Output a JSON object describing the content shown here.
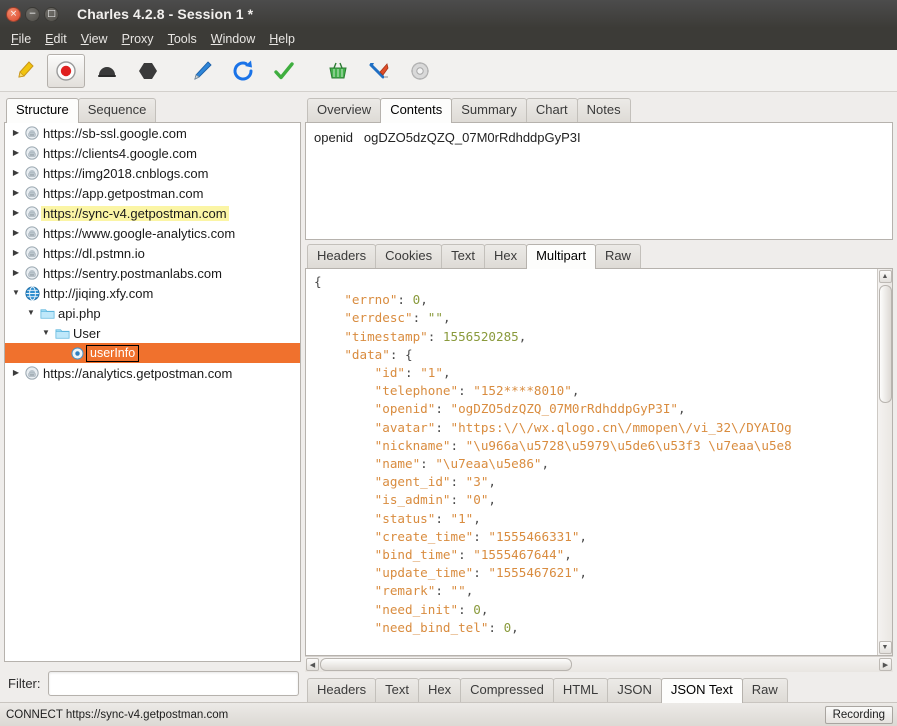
{
  "window": {
    "title": "Charles 4.2.8 - Session 1 *",
    "close_label": "×",
    "minimize_label": "−",
    "maximize_label": "□"
  },
  "menubar": {
    "items": [
      {
        "label": "File",
        "mnemonic": "F"
      },
      {
        "label": "Edit",
        "mnemonic": "E"
      },
      {
        "label": "View",
        "mnemonic": "V"
      },
      {
        "label": "Proxy",
        "mnemonic": "P"
      },
      {
        "label": "Tools",
        "mnemonic": "T"
      },
      {
        "label": "Window",
        "mnemonic": "W"
      },
      {
        "label": "Help",
        "mnemonic": "H"
      }
    ]
  },
  "toolbar": {
    "buttons": [
      {
        "name": "clear-session-icon",
        "title": "Clear Session",
        "active": false
      },
      {
        "name": "record-icon",
        "title": "Start/Stop Recording",
        "active": true
      },
      {
        "name": "throttle-icon",
        "title": "Start/Stop Throttling",
        "active": false
      },
      {
        "name": "breakpoints-icon",
        "title": "Enable/Disable Breakpoints",
        "active": false
      },
      {
        "name": "compose-icon",
        "title": "Compose a new request",
        "active": false
      },
      {
        "name": "repeat-icon",
        "title": "Repeat the selected request",
        "active": false
      },
      {
        "name": "validate-icon",
        "title": "Validate the selected request",
        "active": false
      },
      {
        "name": "tools-basket-icon",
        "title": "Tools",
        "active": false
      },
      {
        "name": "settings-tools-icon",
        "title": "Settings",
        "active": false
      },
      {
        "name": "gear-icon",
        "title": "Preferences",
        "active": false
      }
    ]
  },
  "left": {
    "tabs": [
      {
        "label": "Structure",
        "selected": true
      },
      {
        "label": "Sequence",
        "selected": false
      }
    ],
    "tree": [
      {
        "label": "https://sb-ssl.google.com",
        "depth": 0,
        "icon": "secure-host-icon",
        "twisty": "collapsed",
        "state": "normal"
      },
      {
        "label": "https://clients4.google.com",
        "depth": 0,
        "icon": "secure-host-icon",
        "twisty": "collapsed",
        "state": "normal"
      },
      {
        "label": "https://img2018.cnblogs.com",
        "depth": 0,
        "icon": "secure-host-icon",
        "twisty": "collapsed",
        "state": "normal"
      },
      {
        "label": "https://app.getpostman.com",
        "depth": 0,
        "icon": "secure-host-icon",
        "twisty": "collapsed",
        "state": "normal"
      },
      {
        "label": "https://sync-v4.getpostman.com",
        "depth": 0,
        "icon": "secure-host-icon",
        "twisty": "collapsed",
        "state": "highlighted"
      },
      {
        "label": "https://www.google-analytics.com",
        "depth": 0,
        "icon": "secure-host-icon",
        "twisty": "collapsed",
        "state": "normal"
      },
      {
        "label": "https://dl.pstmn.io",
        "depth": 0,
        "icon": "secure-host-icon",
        "twisty": "collapsed",
        "state": "normal"
      },
      {
        "label": "https://sentry.postmanlabs.com",
        "depth": 0,
        "icon": "secure-host-icon",
        "twisty": "collapsed",
        "state": "normal"
      },
      {
        "label": "http://jiqing.xfy.com",
        "depth": 0,
        "icon": "host-icon",
        "twisty": "expanded",
        "state": "normal"
      },
      {
        "label": "api.php",
        "depth": 1,
        "icon": "folder-icon",
        "twisty": "expanded",
        "state": "normal"
      },
      {
        "label": "User",
        "depth": 2,
        "icon": "folder-icon",
        "twisty": "expanded",
        "state": "normal"
      },
      {
        "label": "userInfo",
        "depth": 3,
        "icon": "endpoint-icon",
        "twisty": "none",
        "state": "selected"
      },
      {
        "label": "https://analytics.getpostman.com",
        "depth": 0,
        "icon": "secure-host-icon",
        "twisty": "collapsed",
        "state": "normal"
      }
    ],
    "filter": {
      "label": "Filter:",
      "value": "",
      "placeholder": ""
    }
  },
  "right": {
    "tabs": [
      {
        "label": "Overview",
        "selected": false
      },
      {
        "label": "Contents",
        "selected": true
      },
      {
        "label": "Summary",
        "selected": false
      },
      {
        "label": "Chart",
        "selected": false
      },
      {
        "label": "Notes",
        "selected": false
      }
    ],
    "request": {
      "multipart_line": "openid   ogDZO5dzQZQ_07M0rRdhddpGyP3I",
      "tabs": [
        {
          "label": "Headers",
          "selected": false
        },
        {
          "label": "Cookies",
          "selected": false
        },
        {
          "label": "Text",
          "selected": false
        },
        {
          "label": "Hex",
          "selected": false
        },
        {
          "label": "Multipart",
          "selected": true
        },
        {
          "label": "Raw",
          "selected": false
        }
      ]
    },
    "response": {
      "tabs": [
        {
          "label": "Headers",
          "selected": false
        },
        {
          "label": "Text",
          "selected": false
        },
        {
          "label": "Hex",
          "selected": false
        },
        {
          "label": "Compressed",
          "selected": false
        },
        {
          "label": "HTML",
          "selected": false
        },
        {
          "label": "JSON",
          "selected": false
        },
        {
          "label": "JSON Text",
          "selected": true
        },
        {
          "label": "Raw",
          "selected": false
        }
      ],
      "json_lines": [
        [
          {
            "t": "p",
            "s": "{"
          }
        ],
        [
          {
            "t": "p",
            "s": "    "
          },
          {
            "t": "k",
            "s": "\"errno\""
          },
          {
            "t": "p",
            "s": ": "
          },
          {
            "t": "v",
            "s": "0"
          },
          {
            "t": "p",
            "s": ","
          }
        ],
        [
          {
            "t": "p",
            "s": "    "
          },
          {
            "t": "k",
            "s": "\"errdesc\""
          },
          {
            "t": "p",
            "s": ": "
          },
          {
            "t": "v",
            "s": "\"\""
          },
          {
            "t": "p",
            "s": ","
          }
        ],
        [
          {
            "t": "p",
            "s": "    "
          },
          {
            "t": "k",
            "s": "\"timestamp\""
          },
          {
            "t": "p",
            "s": ": "
          },
          {
            "t": "v",
            "s": "1556520285"
          },
          {
            "t": "p",
            "s": ","
          }
        ],
        [
          {
            "t": "p",
            "s": "    "
          },
          {
            "t": "k",
            "s": "\"data\""
          },
          {
            "t": "p",
            "s": ": {"
          }
        ],
        [
          {
            "t": "p",
            "s": "        "
          },
          {
            "t": "k",
            "s": "\"id\""
          },
          {
            "t": "p",
            "s": ": "
          },
          {
            "t": "k",
            "s": "\"1\""
          },
          {
            "t": "p",
            "s": ","
          }
        ],
        [
          {
            "t": "p",
            "s": "        "
          },
          {
            "t": "k",
            "s": "\"telephone\""
          },
          {
            "t": "p",
            "s": ": "
          },
          {
            "t": "k",
            "s": "\"152****8010\""
          },
          {
            "t": "p",
            "s": ","
          }
        ],
        [
          {
            "t": "p",
            "s": "        "
          },
          {
            "t": "k",
            "s": "\"openid\""
          },
          {
            "t": "p",
            "s": ": "
          },
          {
            "t": "k",
            "s": "\"ogDZO5dzQZQ_07M0rRdhddpGyP3I\""
          },
          {
            "t": "p",
            "s": ","
          }
        ],
        [
          {
            "t": "p",
            "s": "        "
          },
          {
            "t": "k",
            "s": "\"avatar\""
          },
          {
            "t": "p",
            "s": ": "
          },
          {
            "t": "k",
            "s": "\"https:\\/\\/wx.qlogo.cn\\/mmopen\\/vi_32\\/DYAIOg"
          }
        ],
        [
          {
            "t": "p",
            "s": "        "
          },
          {
            "t": "k",
            "s": "\"nickname\""
          },
          {
            "t": "p",
            "s": ": "
          },
          {
            "t": "k",
            "s": "\"\\u966a\\u5728\\u5979\\u5de6\\u53f3 \\u7eaa\\u5e8"
          }
        ],
        [
          {
            "t": "p",
            "s": "        "
          },
          {
            "t": "k",
            "s": "\"name\""
          },
          {
            "t": "p",
            "s": ": "
          },
          {
            "t": "k",
            "s": "\"\\u7eaa\\u5e86\""
          },
          {
            "t": "p",
            "s": ","
          }
        ],
        [
          {
            "t": "p",
            "s": "        "
          },
          {
            "t": "k",
            "s": "\"agent_id\""
          },
          {
            "t": "p",
            "s": ": "
          },
          {
            "t": "k",
            "s": "\"3\""
          },
          {
            "t": "p",
            "s": ","
          }
        ],
        [
          {
            "t": "p",
            "s": "        "
          },
          {
            "t": "k",
            "s": "\"is_admin\""
          },
          {
            "t": "p",
            "s": ": "
          },
          {
            "t": "k",
            "s": "\"0\""
          },
          {
            "t": "p",
            "s": ","
          }
        ],
        [
          {
            "t": "p",
            "s": "        "
          },
          {
            "t": "k",
            "s": "\"status\""
          },
          {
            "t": "p",
            "s": ": "
          },
          {
            "t": "k",
            "s": "\"1\""
          },
          {
            "t": "p",
            "s": ","
          }
        ],
        [
          {
            "t": "p",
            "s": "        "
          },
          {
            "t": "k",
            "s": "\"create_time\""
          },
          {
            "t": "p",
            "s": ": "
          },
          {
            "t": "k",
            "s": "\"1555466331\""
          },
          {
            "t": "p",
            "s": ","
          }
        ],
        [
          {
            "t": "p",
            "s": "        "
          },
          {
            "t": "k",
            "s": "\"bind_time\""
          },
          {
            "t": "p",
            "s": ": "
          },
          {
            "t": "k",
            "s": "\"1555467644\""
          },
          {
            "t": "p",
            "s": ","
          }
        ],
        [
          {
            "t": "p",
            "s": "        "
          },
          {
            "t": "k",
            "s": "\"update_time\""
          },
          {
            "t": "p",
            "s": ": "
          },
          {
            "t": "k",
            "s": "\"1555467621\""
          },
          {
            "t": "p",
            "s": ","
          }
        ],
        [
          {
            "t": "p",
            "s": "        "
          },
          {
            "t": "k",
            "s": "\"remark\""
          },
          {
            "t": "p",
            "s": ": "
          },
          {
            "t": "k",
            "s": "\"\""
          },
          {
            "t": "p",
            "s": ","
          }
        ],
        [
          {
            "t": "p",
            "s": "        "
          },
          {
            "t": "k",
            "s": "\"need_init\""
          },
          {
            "t": "p",
            "s": ": "
          },
          {
            "t": "v",
            "s": "0"
          },
          {
            "t": "p",
            "s": ","
          }
        ],
        [
          {
            "t": "p",
            "s": "        "
          },
          {
            "t": "k",
            "s": "\"need_bind_tel\""
          },
          {
            "t": "p",
            "s": ": "
          },
          {
            "t": "v",
            "s": "0"
          },
          {
            "t": "p",
            "s": ","
          }
        ]
      ]
    }
  },
  "statusbar": {
    "message": "CONNECT https://sync-v4.getpostman.com",
    "recording_label": "Recording"
  },
  "colors": {
    "selection_orange": "#f0712d",
    "highlight_yellow": "#fbf5a5",
    "json_key": "#d98c3f",
    "json_value": "#8a9a3c",
    "titlebar": "#3c3b37"
  }
}
